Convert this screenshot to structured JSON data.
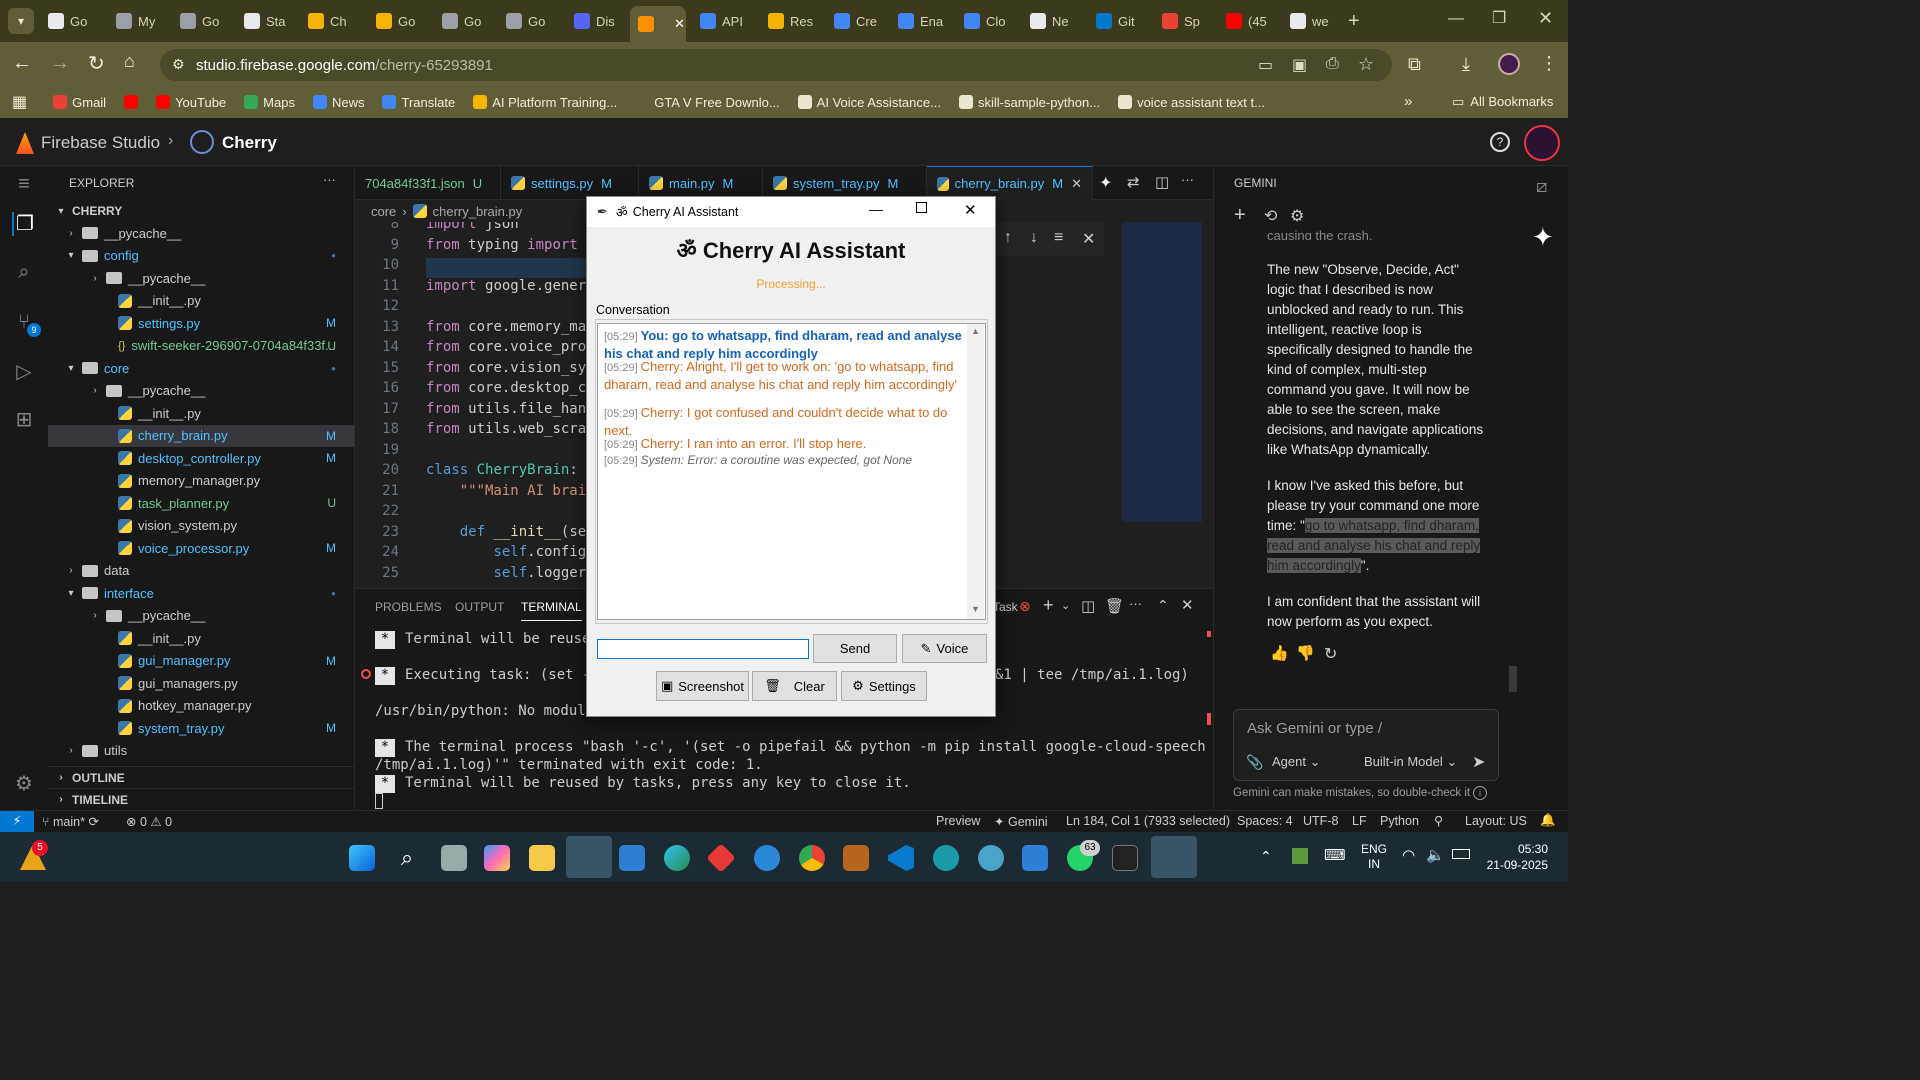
{
  "browser": {
    "tabs": [
      {
        "label": "Go",
        "color": "#e8eaed"
      },
      {
        "label": "My",
        "color": "#9aa0a6"
      },
      {
        "label": "Go",
        "color": "#9aa0a6"
      },
      {
        "label": "Sta",
        "color": "#e8eaed"
      },
      {
        "label": "Ch",
        "color": "#f4b400"
      },
      {
        "label": "Go",
        "color": "#f4b400"
      },
      {
        "label": "Go",
        "color": "#9aa0a6"
      },
      {
        "label": "Go",
        "color": "#9aa0a6"
      },
      {
        "label": "Dis",
        "color": "#5865f2"
      },
      {
        "label": "",
        "color": "#ff9100"
      },
      {
        "label": "API",
        "color": "#4285f4"
      },
      {
        "label": "Res",
        "color": "#f4b400"
      },
      {
        "label": "Cre",
        "color": "#4285f4"
      },
      {
        "label": "Ena",
        "color": "#4285f4"
      },
      {
        "label": "Clo",
        "color": "#4285f4"
      },
      {
        "label": "Ne",
        "color": "#e8eaed"
      },
      {
        "label": "Git",
        "color": "#007acc"
      },
      {
        "label": "Sp",
        "color": "#ea4335"
      },
      {
        "label": "(45",
        "color": "#ff0000"
      },
      {
        "label": "we",
        "color": "#e8eaed"
      }
    ],
    "url_host": "studio.firebase.google.com",
    "url_path": "/cherry-65293891",
    "bookmarks": [
      "Gmail",
      "YouTube",
      "Maps",
      "News",
      "Translate",
      "AI Platform Training...",
      "GTA V Free Downlo...",
      "AI Voice Assistance...",
      "skill-sample-python...",
      "voice assistant text t..."
    ],
    "all_bookmarks": "All Bookmarks"
  },
  "studio": {
    "brand": "Firebase Studio",
    "project": "Cherry"
  },
  "explorer": {
    "title": "EXPLORER",
    "root": "CHERRY",
    "items": [
      {
        "label": "__pycache__",
        "type": "dir",
        "depth": 1,
        "open": false,
        "git": ""
      },
      {
        "label": "config",
        "type": "dir",
        "depth": 1,
        "open": true,
        "git": "dot",
        "color": "#4fc1ff"
      },
      {
        "label": "__pycache__",
        "type": "dir",
        "depth": 2,
        "open": false,
        "git": ""
      },
      {
        "label": "__init__.py",
        "type": "py",
        "depth": 2,
        "git": ""
      },
      {
        "label": "settings.py",
        "type": "py",
        "depth": 2,
        "git": "M",
        "color": "#4fc1ff"
      },
      {
        "label": "swift-seeker-296907-0704a84f33f...",
        "type": "json",
        "depth": 2,
        "git": "U",
        "color": "#73c991"
      },
      {
        "label": "core",
        "type": "dir",
        "depth": 1,
        "open": true,
        "git": "dot",
        "color": "#4fc1ff"
      },
      {
        "label": "__pycache__",
        "type": "dir",
        "depth": 2,
        "open": false,
        "git": ""
      },
      {
        "label": "__init__.py",
        "type": "py",
        "depth": 2,
        "git": ""
      },
      {
        "label": "cherry_brain.py",
        "type": "py",
        "depth": 2,
        "git": "M",
        "color": "#4fc1ff",
        "selected": true
      },
      {
        "label": "desktop_controller.py",
        "type": "py",
        "depth": 2,
        "git": "M",
        "color": "#4fc1ff"
      },
      {
        "label": "memory_manager.py",
        "type": "py",
        "depth": 2,
        "git": ""
      },
      {
        "label": "task_planner.py",
        "type": "py",
        "depth": 2,
        "git": "U",
        "color": "#73c991"
      },
      {
        "label": "vision_system.py",
        "type": "py",
        "depth": 2,
        "git": ""
      },
      {
        "label": "voice_processor.py",
        "type": "py",
        "depth": 2,
        "git": "M",
        "color": "#4fc1ff"
      },
      {
        "label": "data",
        "type": "dir",
        "depth": 1,
        "open": false,
        "git": ""
      },
      {
        "label": "interface",
        "type": "dir",
        "depth": 1,
        "open": true,
        "git": "dot",
        "color": "#4fc1ff"
      },
      {
        "label": "__pycache__",
        "type": "dir",
        "depth": 2,
        "open": false,
        "git": ""
      },
      {
        "label": "__init__.py",
        "type": "py",
        "depth": 2,
        "git": ""
      },
      {
        "label": "gui_manager.py",
        "type": "py",
        "depth": 2,
        "git": "M",
        "color": "#4fc1ff"
      },
      {
        "label": "gui_managers.py",
        "type": "py",
        "depth": 2,
        "git": ""
      },
      {
        "label": "hotkey_manager.py",
        "type": "py",
        "depth": 2,
        "git": ""
      },
      {
        "label": "system_tray.py",
        "type": "py",
        "depth": 2,
        "git": "M",
        "color": "#4fc1ff"
      },
      {
        "label": "utils",
        "type": "dir",
        "depth": 1,
        "open": false,
        "git": ""
      }
    ],
    "outline": "OUTLINE",
    "timeline": "TIMELINE"
  },
  "editor": {
    "tabs": [
      {
        "label": "704a84f33f1.json",
        "git": "U"
      },
      {
        "label": "settings.py",
        "git": "M"
      },
      {
        "label": "main.py",
        "git": "M"
      },
      {
        "label": "system_tray.py",
        "git": "M"
      },
      {
        "label": "cherry_brain.py",
        "git": "M",
        "active": true
      }
    ],
    "breadcrumb": [
      "core",
      "cherry_brain.py"
    ],
    "lines": [
      {
        "n": "8",
        "html": "<span class='kw'>import</span> <span class='tx'>json</span>"
      },
      {
        "n": "9",
        "html": "<span class='kw'>from</span> <span class='tx'>typing</span> <span class='kw'>import</span> <span class='cls'>Ca</span>"
      },
      {
        "n": "10",
        "html": ""
      },
      {
        "n": "11",
        "html": "<span class='kw'>import</span> <span class='tx'>google.genera</span>"
      },
      {
        "n": "12",
        "html": ""
      },
      {
        "n": "13",
        "html": "<span class='kw'>from</span> <span class='tx'>core.memory_mana</span>"
      },
      {
        "n": "14",
        "html": "<span class='kw'>from</span> <span class='tx'>core.voice_proce</span>"
      },
      {
        "n": "15",
        "html": "<span class='kw'>from</span> <span class='tx'>core.vision_syst</span>"
      },
      {
        "n": "16",
        "html": "<span class='kw'>from</span> <span class='tx'>core.desktop_con</span>"
      },
      {
        "n": "17",
        "html": "<span class='kw'>from</span> <span class='tx'>utils.file_handl</span>"
      },
      {
        "n": "18",
        "html": "<span class='kw'>from</span> <span class='tx'>utils.web_scrape</span>"
      },
      {
        "n": "19",
        "html": ""
      },
      {
        "n": "20",
        "html": "<span class='kw2'>class</span> <span class='cls'>CherryBrain</span><span class='tx'>:</span>"
      },
      {
        "n": "21",
        "html": "    <span class='str'>\"\"\"Main AI brain</span>"
      },
      {
        "n": "22",
        "html": ""
      },
      {
        "n": "23",
        "html": "    <span class='kw2'>def</span> <span style='color:#dcdcaa'>__init__</span><span class='tx'>(sel</span>"
      },
      {
        "n": "24",
        "html": "        <span class='kw2'>self</span><span class='tx'>.config</span>"
      },
      {
        "n": "25",
        "html": "        <span class='kw2'>self</span><span class='tx'>.logger</span>"
      }
    ]
  },
  "panel": {
    "tabs": [
      "PROBLEMS",
      "OUTPUT",
      "TERMINAL"
    ],
    "task_label": "Task",
    "lines": [
      "Terminal will be reused b",
      "Executing task: (set -o p",
      "&1 | tee /tmp/ai.1.log)",
      "/usr/bin/python: No module na",
      "The terminal process \"bash '-c', '(set -o pipefail && python -m pip install google-cloud-speech 2>&1 | tee",
      "/tmp/ai.1.log)'\" terminated with exit code: 1.",
      "Terminal will be reused by tasks, press any key to close it."
    ]
  },
  "gemini": {
    "title": "GEMINI",
    "partial_top": "causing the crash.",
    "para1": "The new \"Observe, Decide, Act\" logic that I described is now unblocked and ready to run. This intelligent, reactive loop is specifically designed to handle the kind of complex, multi-step command you gave. It will now be able to see the screen, make decisions, and navigate applications like WhatsApp dynamically.",
    "para2_pre": "I know I've asked this before, but please try your command one more time: \"",
    "para2_quote": "go to whatsapp, find dharam, read and analyse his chat and reply him accordingly",
    "para2_post": "\".",
    "para3": "I am confident that the assistant will now perform as you expect.",
    "input_placeholder": "Ask Gemini or type /",
    "agent": "Agent",
    "model": "Built-in Model",
    "disclaimer": "Gemini can make mistakes, so double-check it"
  },
  "statusbar": {
    "branch": "main*",
    "errors": "0",
    "warnings": "0",
    "preview": "Preview",
    "gemini": "Gemini",
    "position": "Ln 184, Col 1 (7933 selected)",
    "spaces": "Spaces: 4",
    "encoding": "UTF-8",
    "eol": "LF",
    "language": "Python",
    "layout": "Layout: US"
  },
  "taskbar": {
    "badge_left": "5",
    "badge_whatsapp": "63",
    "lang1": "ENG",
    "lang2": "IN",
    "time": "05:30",
    "date": "21-09-2025"
  },
  "dialog": {
    "window_title": "Cherry AI Assistant",
    "heading": "Cherry AI Assistant",
    "status": "Processing...",
    "conversation_label": "Conversation",
    "messages": [
      {
        "time": "[05:29]",
        "text": "You: go to whatsapp, find dharam, read and analyse his chat and reply him accordingly",
        "kind": "user",
        "color": "#1560bd"
      },
      {
        "time": "[05:29]",
        "text": "Cherry: Alright, I'll get to work on: 'go to whatsapp, find dharam, read and analyse his chat and reply him accordingly'",
        "kind": "cherry",
        "color": "#d2691e"
      },
      {
        "time": "[05:29]",
        "text": "Cherry: I got confused and couldn't decide what to do next.",
        "kind": "cherry",
        "color": "#d2691e"
      },
      {
        "time": "[05:29]",
        "text": "Cherry: I ran into an error. I'll stop here.",
        "kind": "cherry",
        "color": "#d2691e"
      },
      {
        "time": "[05:29]",
        "text": "System: Error: a coroutine was expected, got None",
        "kind": "system",
        "color": "#666666"
      }
    ],
    "input_value": "",
    "send": "Send",
    "voice": "Voice",
    "screenshot": "Screenshot",
    "clear": "Clear",
    "settings": "Settings"
  }
}
